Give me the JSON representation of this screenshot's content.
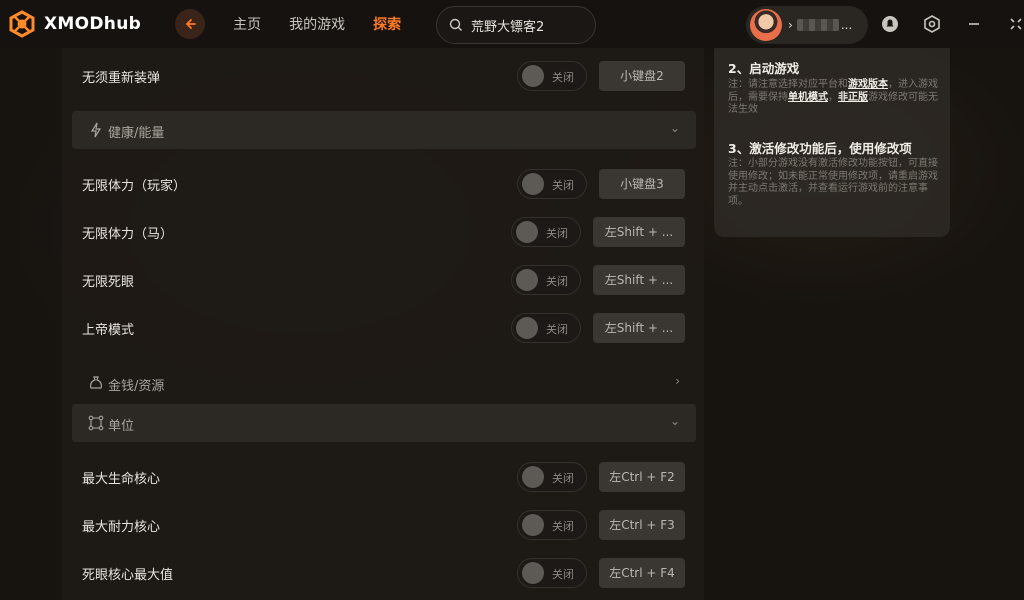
{
  "app": {
    "name_x": "XMOD",
    "name_hub": "hub",
    "brand_color": "#ff7a26"
  },
  "nav": {
    "home": "主页",
    "my_games": "我的游戏",
    "explore": "探索"
  },
  "search": {
    "value": "荒野大镖客2"
  },
  "user": {
    "chevron": "›",
    "name_suffix": "..."
  },
  "rows_top": [
    {
      "label": "无须重新装弹",
      "toggle": "关闭",
      "hotkey": "小键盘2"
    }
  ],
  "sections": {
    "health": "健康/能量",
    "money": "金钱/资源",
    "unit": "单位"
  },
  "health_rows": [
    {
      "label": "无限体力（玩家）",
      "toggle": "关闭",
      "hotkey": "小键盘3"
    },
    {
      "label": "无限体力（马）",
      "toggle": "关闭",
      "hotkey": "左Shift + ..."
    },
    {
      "label": "无限死眼",
      "toggle": "关闭",
      "hotkey": "左Shift + ..."
    },
    {
      "label": "上帝模式",
      "toggle": "关闭",
      "hotkey": "左Shift + ..."
    }
  ],
  "unit_rows": [
    {
      "label": "最大生命核心",
      "toggle": "关闭",
      "hotkey": "左Ctrl + F2"
    },
    {
      "label": "最大耐力核心",
      "toggle": "关闭",
      "hotkey": "左Ctrl + F3"
    },
    {
      "label": "死眼核心最大值",
      "toggle": "关闭",
      "hotkey": "左Ctrl + F4"
    }
  ],
  "info": {
    "step2_title": "2、启动游戏",
    "step2_note_a": "注：请注意选择对应平台和",
    "step2_link1": "游戏版本",
    "step2_note_b": "，进入游戏后，需要保持",
    "step2_link2": "单机模式",
    "step2_note_c": "，",
    "step2_link3": "非正版",
    "step2_note_d": "游戏修改可能无法生效",
    "step3_title": "3、激活修改功能后，使用修改项",
    "step3_note": "注：小部分游戏没有激活修改功能按钮，可直接使用修改；如未能正常使用修改项，请重启游戏并主动点击激活，并查看运行游戏前的注意事项。"
  }
}
